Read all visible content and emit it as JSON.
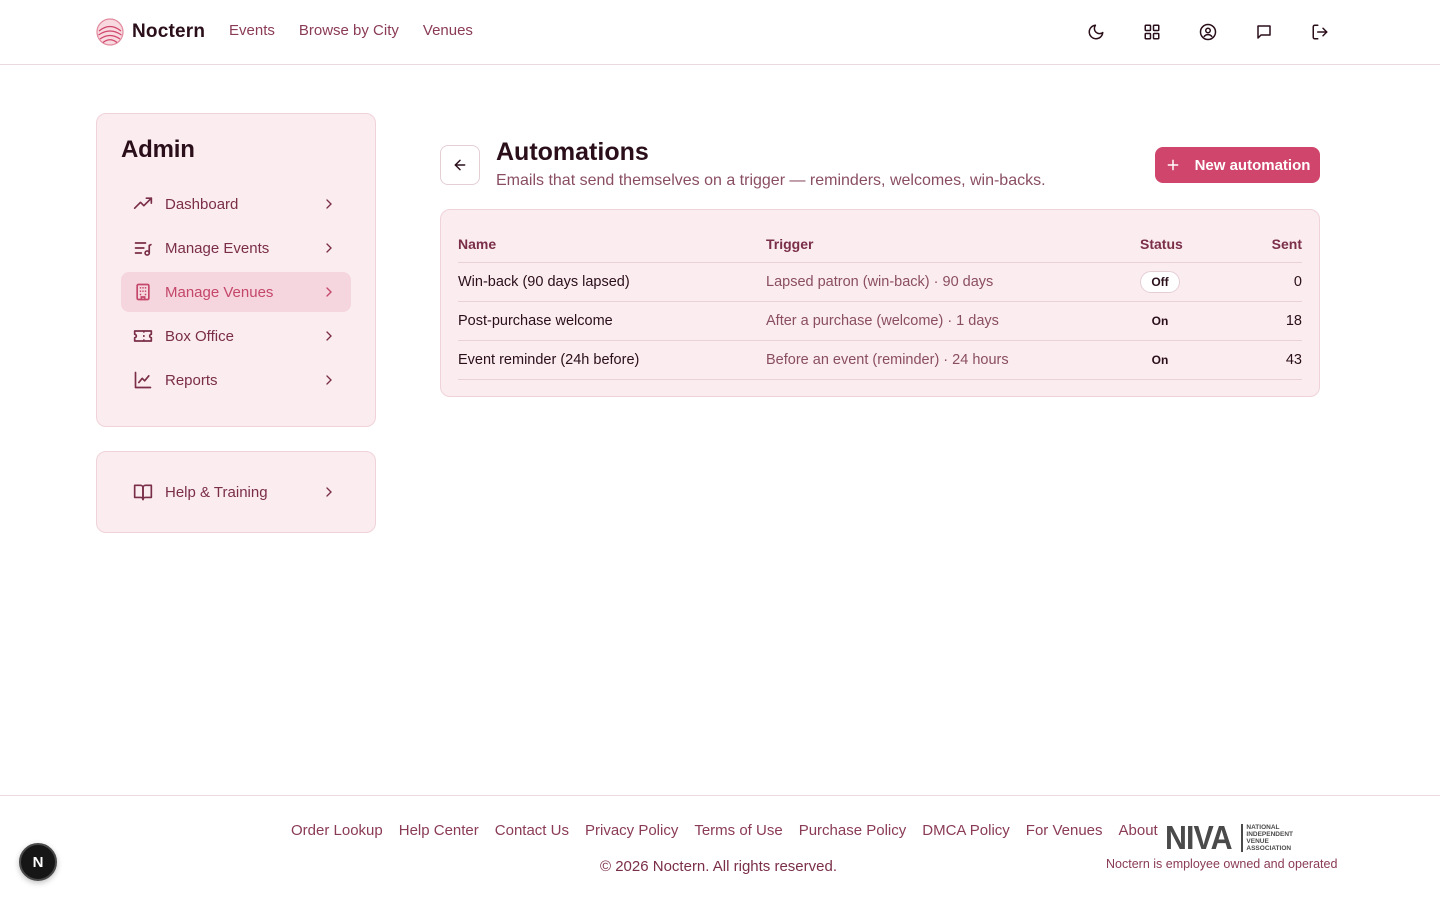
{
  "header": {
    "brand": "Noctern",
    "nav": [
      "Events",
      "Browse by City",
      "Venues"
    ],
    "icons": [
      "moon-icon",
      "grid-icon",
      "account-icon",
      "chat-icon",
      "logout-icon"
    ]
  },
  "sidebar": {
    "title": "Admin",
    "items": [
      {
        "label": "Dashboard",
        "icon": "trending-up-icon",
        "active": false
      },
      {
        "label": "Manage Events",
        "icon": "list-music-icon",
        "active": false
      },
      {
        "label": "Manage Venues",
        "icon": "building-icon",
        "active": true
      },
      {
        "label": "Box Office",
        "icon": "ticket-icon",
        "active": false
      },
      {
        "label": "Reports",
        "icon": "chart-line-icon",
        "active": false
      }
    ],
    "help": {
      "label": "Help & Training",
      "icon": "book-icon"
    }
  },
  "main": {
    "title": "Automations",
    "subtitle": "Emails that send themselves on a trigger — reminders, welcomes, win-backs.",
    "new_button": "New automation",
    "table": {
      "headers": {
        "name": "Name",
        "trigger": "Trigger",
        "status": "Status",
        "sent": "Sent"
      },
      "rows": [
        {
          "name": "Win-back (90 days lapsed)",
          "trigger": "Lapsed patron (win-back) · 90 days",
          "status": "Off",
          "sent": "0"
        },
        {
          "name": "Post-purchase welcome",
          "trigger": "After a purchase (welcome) · 1 days",
          "status": "On",
          "sent": "18"
        },
        {
          "name": "Event reminder (24h before)",
          "trigger": "Before an event (reminder) · 24 hours",
          "status": "On",
          "sent": "43"
        }
      ]
    }
  },
  "footer": {
    "links": [
      "Order Lookup",
      "Help Center",
      "Contact Us",
      "Privacy Policy",
      "Terms of Use",
      "Purchase Policy",
      "DMCA Policy",
      "For Venues",
      "About"
    ],
    "copyright": "© 2026 Noctern. All rights reserved.",
    "niva_logo": "NIVA",
    "niva_full": "NATIONAL INDEPENDENT VENUE ASSOCIATION",
    "employee_note": "Noctern is employee owned and operated"
  },
  "fab": {
    "label": "N"
  },
  "colors": {
    "accent": "#d0456b",
    "card_bg": "#fbecef",
    "active_bg": "#f6d6de",
    "text_primary": "#2a0f1a",
    "text_link": "#8a3b55"
  }
}
